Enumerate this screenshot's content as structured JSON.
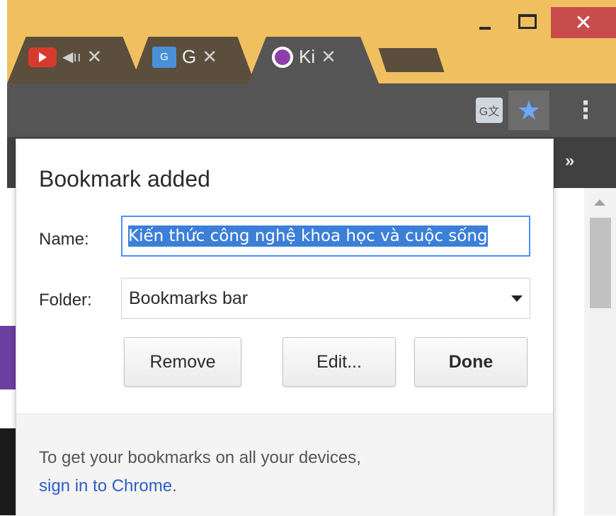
{
  "window": {
    "minimize_icon": "minimize-icon",
    "maximize_icon": "maximize-icon",
    "close_glyph": "✕",
    "frame_color": "#f0c060",
    "close_color": "#c94c4c"
  },
  "tabs": [
    {
      "icon": "youtube-icon",
      "audio_icon": "audio-playing-icon",
      "title": "",
      "close": "✕"
    },
    {
      "icon": "google-translate-icon",
      "title": "G",
      "close": "✕"
    },
    {
      "icon": "site-icon",
      "title": "Ki",
      "close": "✕",
      "active": true
    }
  ],
  "toolbar": {
    "translate_icon": "translate-icon",
    "star_glyph": "★",
    "star_color": "#6fa8ff",
    "menu_glyph": "⋮"
  },
  "bookmarks_bar": {
    "more_glyph": "»"
  },
  "dialog": {
    "title": "Bookmark added",
    "name_label": "Name:",
    "name_value": "Kiến thức công nghệ khoa học và cuộc sống",
    "folder_label": "Folder:",
    "folder_value": "Bookmarks bar",
    "remove_label": "Remove",
    "edit_label": "Edit...",
    "done_label": "Done",
    "footer_text": "To get your bookmarks on all your devices,",
    "footer_link": "sign in to Chrome",
    "footer_period": "."
  }
}
